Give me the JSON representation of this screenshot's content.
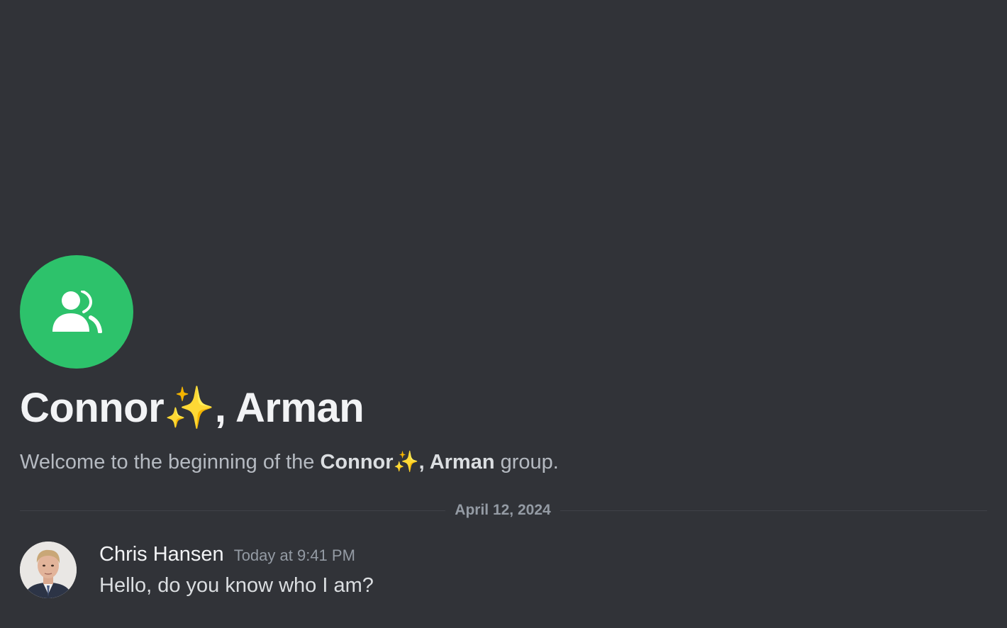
{
  "channel": {
    "icon": "group-dm-icon",
    "icon_color": "#2dc26b",
    "title": "Connor✨, Arman",
    "welcome": {
      "prefix": "Welcome to the beginning of the ",
      "group_name": "Connor✨, Arman",
      "suffix": " group."
    }
  },
  "divider": {
    "date": "April 12, 2024"
  },
  "messages": [
    {
      "author": "Chris Hansen",
      "timestamp": "Today at 9:41 PM",
      "content": "Hello, do you know who I am?",
      "avatar": "user-avatar-photo"
    }
  ],
  "colors": {
    "background": "#313338",
    "title_text": "#f2f3f5",
    "muted_text": "#b5bac1",
    "timestamp_text": "#949ba4",
    "message_text": "#dbdee1"
  }
}
